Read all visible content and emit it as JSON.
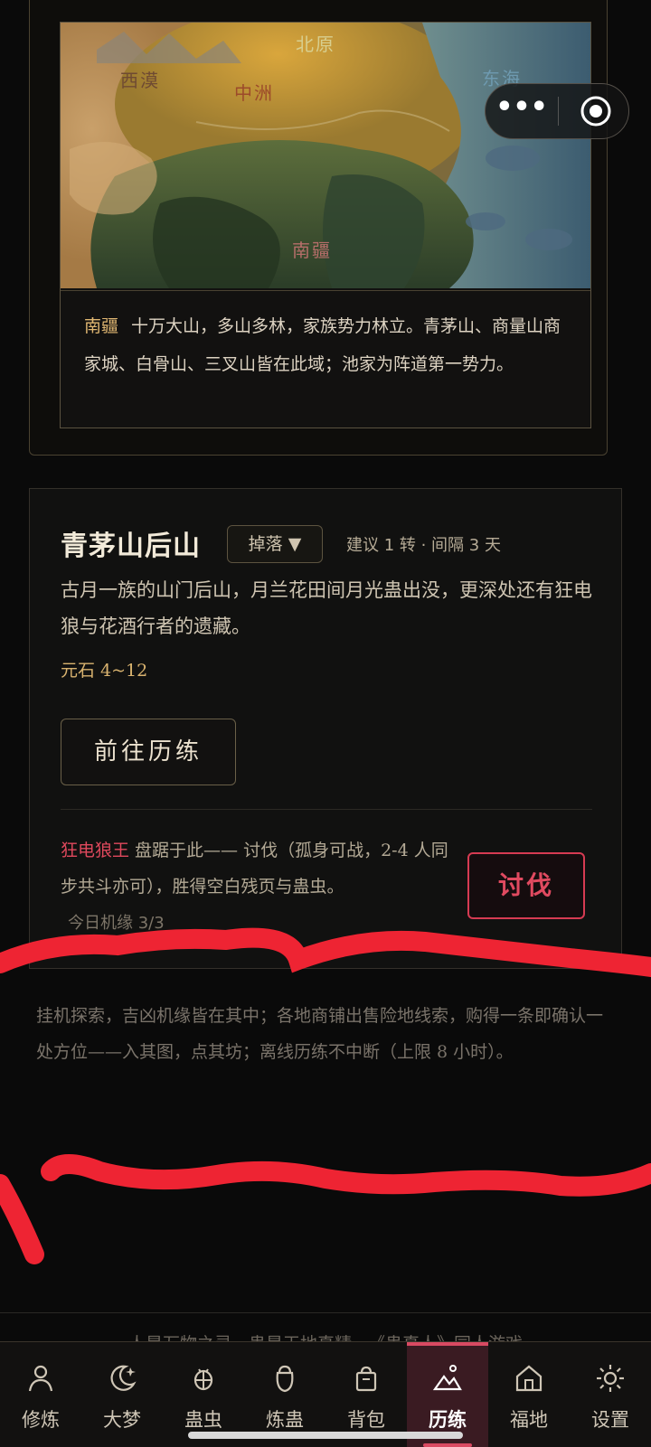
{
  "map": {
    "labels": {
      "north": "北原",
      "west": "西漠",
      "center": "中洲",
      "east": "东海",
      "south": "南疆"
    },
    "region_name": "南疆",
    "region_desc": "十万大山，多山多林，家族势力林立。青茅山、商量山商家城、白骨山、三叉山皆在此域；池家为阵道第一势力。"
  },
  "location": {
    "title": "青茅山后山",
    "drop_label": "掉落 ▼",
    "suggest": "建议 1 转 · 间隔 3 天",
    "desc": "古月一族的山门后山，月兰花田间月光蛊出没，更深处还有狂电狼与花酒行者的遗藏。",
    "reward": "元石 4~12",
    "go_button": "前往历练",
    "boss_name": "狂电狼王",
    "boss_desc": " 盘踞于此—— 讨伐（孤身可战，2-4 人同步共斗亦可），胜得空白残页与蛊虫。",
    "fight_button": "讨伐",
    "chance": "今日机缘 3/3"
  },
  "footer_note": "挂机探索，吉凶机缘皆在其中；各地商铺出售险地线索，购得一条即确认一处方位——入其图，点其坊；离线历练不中断（上限 8 小时）。",
  "credit": "人是万物之灵，蛊是天地真精 · 《蛊真人》同人游戏",
  "capsule": {
    "more": "•••"
  },
  "nav": [
    {
      "label": "修炼",
      "icon": "person-icon"
    },
    {
      "label": "大梦",
      "icon": "moon-icon"
    },
    {
      "label": "蛊虫",
      "icon": "bug-icon"
    },
    {
      "label": "炼蛊",
      "icon": "cauldron-icon"
    },
    {
      "label": "背包",
      "icon": "bag-icon"
    },
    {
      "label": "历练",
      "icon": "mountain-icon",
      "active": true
    },
    {
      "label": "福地",
      "icon": "house-icon"
    },
    {
      "label": "设置",
      "icon": "gear-icon"
    }
  ],
  "colors": {
    "accent_red": "#d94a62",
    "gold": "#d9b36f",
    "background": "#0a0a0a"
  }
}
